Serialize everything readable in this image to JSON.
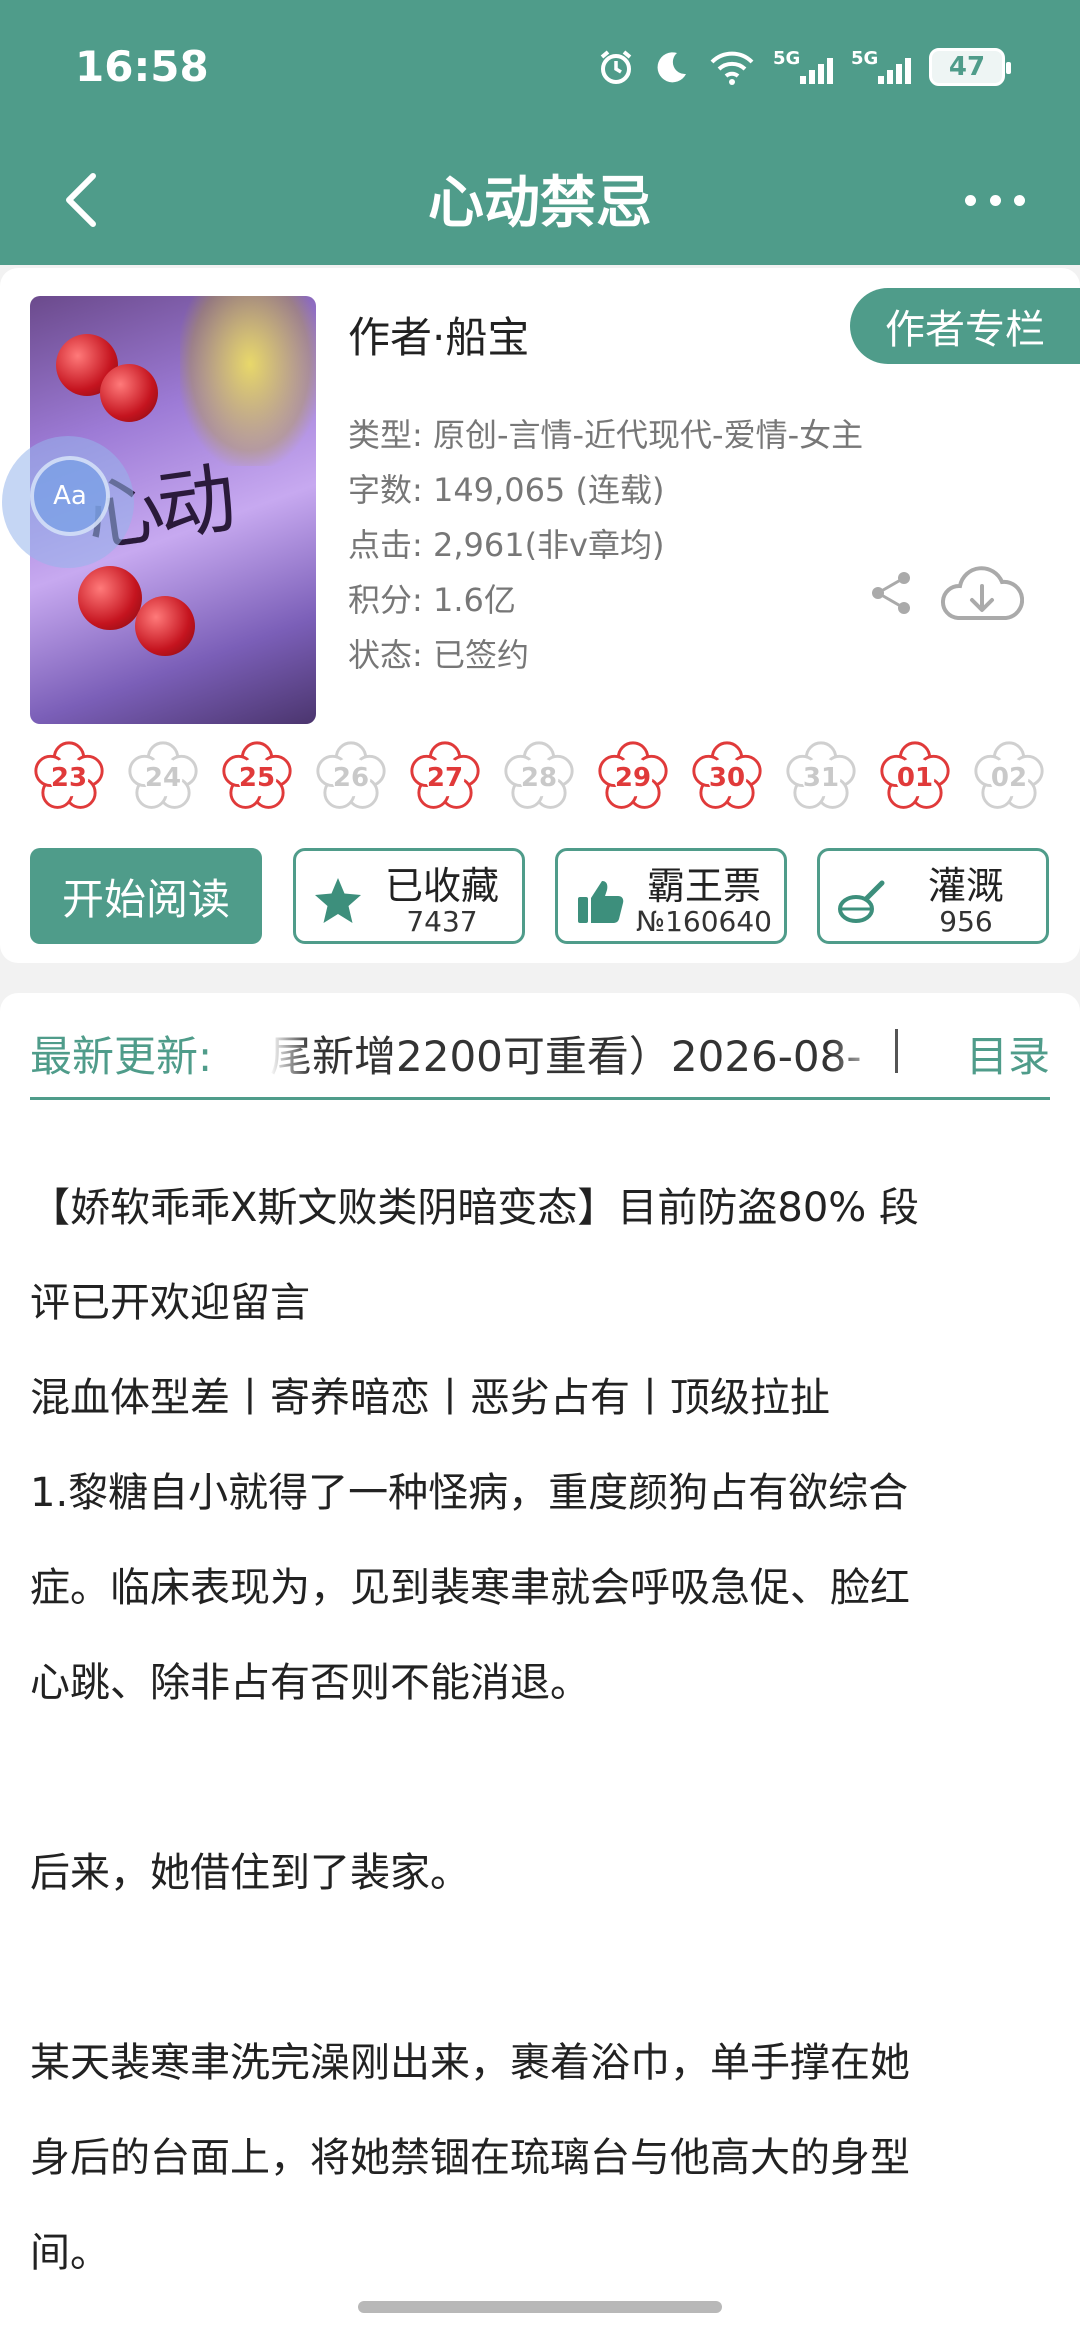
{
  "status_bar": {
    "time": "16:58",
    "net1": "5G",
    "net2": "5G",
    "battery": "47"
  },
  "header": {
    "title": "心动禁忌",
    "bg_color": "#4f9c8a"
  },
  "book": {
    "cover_icon": "book-cover",
    "author": "作者·船宝",
    "author_column_label": "作者专栏",
    "meta": [
      "类型: 原创-言情-近代现代-爱情-女主",
      "字数: 149,065 (连载)",
      "点击: 2,961(非v章均)",
      "积分: 1.6亿",
      "状态: 已签约"
    ],
    "reader_button": "Aa"
  },
  "dates": [
    {
      "label": "23",
      "active": true
    },
    {
      "label": "24",
      "active": false
    },
    {
      "label": "25",
      "active": true
    },
    {
      "label": "26",
      "active": false
    },
    {
      "label": "27",
      "active": true
    },
    {
      "label": "28",
      "active": false
    },
    {
      "label": "29",
      "active": true
    },
    {
      "label": "30",
      "active": true
    },
    {
      "label": "31",
      "active": false
    },
    {
      "label": "01",
      "active": true
    },
    {
      "label": "02",
      "active": false
    }
  ],
  "actions": {
    "read_label": "开始阅读",
    "collect": {
      "label": "已收藏",
      "count": "7437"
    },
    "vote": {
      "label": "霸王票",
      "count": "№160640"
    },
    "nutrient": {
      "label": "灌溉",
      "count": "956"
    }
  },
  "update": {
    "label": "最新更新:",
    "text": "尾新增2200可重看）2026-08-",
    "toc_label": "目录"
  },
  "intro": {
    "lines": [
      "【娇软乖乖X斯文败类阴暗变态】目前防盗80% 段",
      "评已开欢迎留言",
      "混血体型差丨寄养暗恋丨恶劣占有丨顶级拉扯",
      "1.黎糖自小就得了一种怪病，重度颜狗占有欲综合",
      "症。临床表现为，见到裴寒聿就会呼吸急促、脸红",
      "心跳、除非占有否则不能消退。",
      "",
      "后来，她借住到了裴家。",
      "",
      "某天裴寒聿洗完澡刚出来，裹着浴巾，单手撑在她",
      "身后的台面上，将她禁锢在琉璃台与他高大的身型",
      "间。"
    ]
  }
}
